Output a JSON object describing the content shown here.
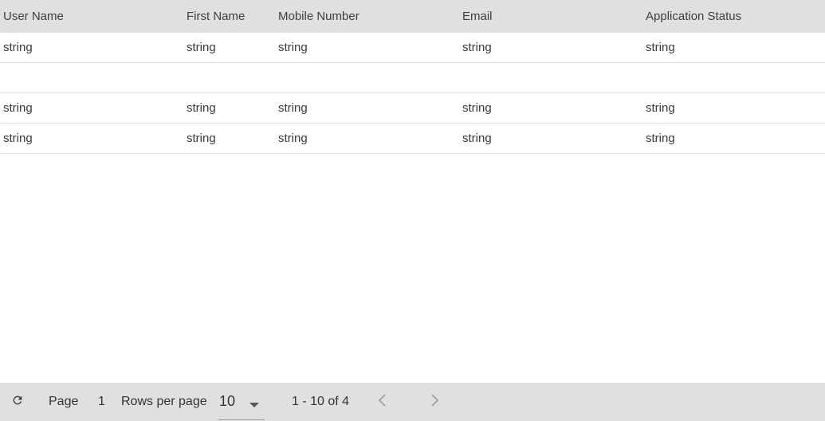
{
  "table": {
    "columns": [
      "User Name",
      "First Name",
      "Mobile Number",
      "Email",
      "Application Status"
    ],
    "rows": [
      [
        "string",
        "string",
        "string",
        "string",
        "string"
      ],
      [
        "",
        "",
        "",
        "",
        ""
      ],
      [
        "string",
        "string",
        "string",
        "string",
        "string"
      ],
      [
        "string",
        "string",
        "string",
        "string",
        "string"
      ]
    ]
  },
  "footer": {
    "refresh_icon": "refresh-icon",
    "page_label": "Page",
    "page_number": "1",
    "rows_per_page_label": "Rows per page",
    "rows_per_page_value": "10",
    "range_text": "1 - 10 of 4",
    "prev_icon": "chevron-left-icon",
    "next_icon": "chevron-right-icon"
  },
  "colors": {
    "header_bg": "#e0e0e0",
    "footer_bg": "#e0e0e0",
    "row_border": "#e2e2e2"
  }
}
